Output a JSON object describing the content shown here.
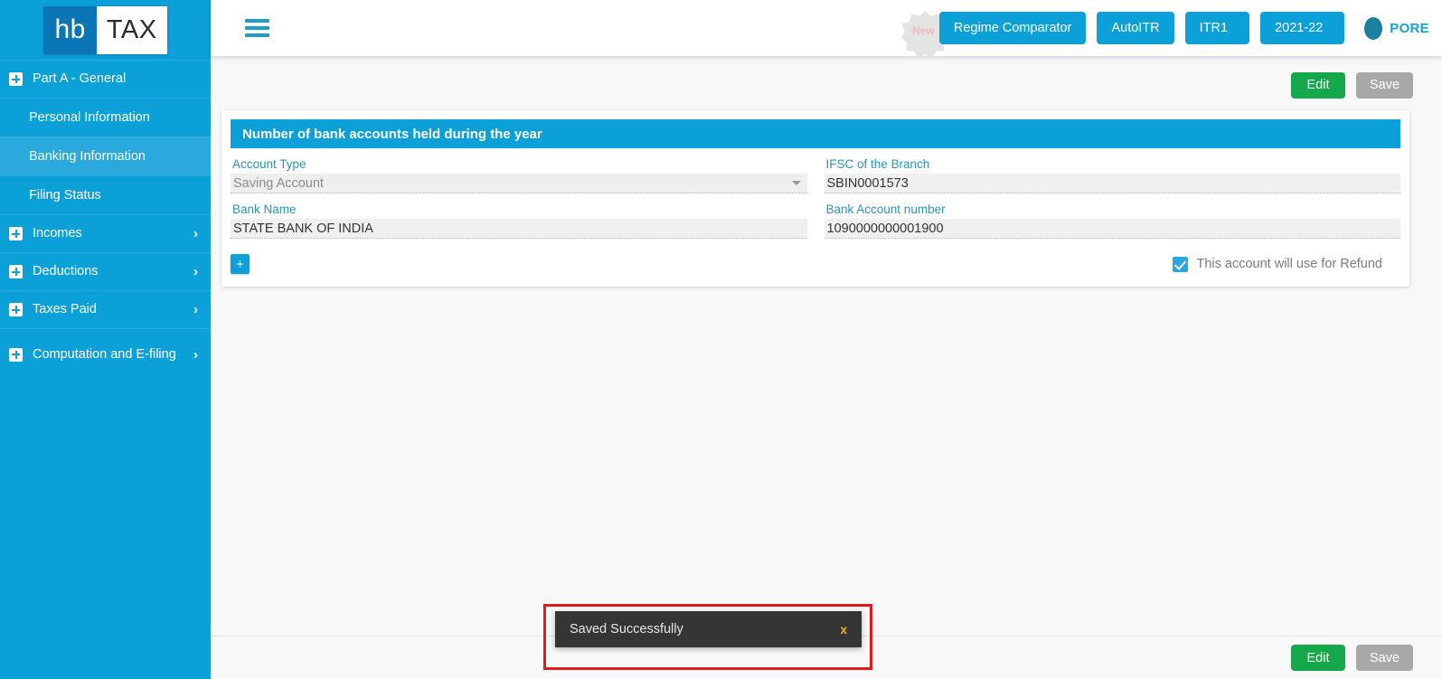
{
  "brand": {
    "logo_primary": "hb",
    "logo_secondary": "TAX",
    "sidebar_color": "#0ca0d8",
    "accent_color": "#0ca0d8",
    "edit_color": "#14a84a",
    "disabled_color": "#a8a8a8"
  },
  "sidebar": {
    "groups": [
      {
        "label": "Part A - General",
        "caret": "ⱟ",
        "children": [
          {
            "label": "Personal Information",
            "active": false
          },
          {
            "label": "Banking Information",
            "active": true
          },
          {
            "label": "Filing Status",
            "active": false
          }
        ]
      },
      {
        "label": "Incomes",
        "caret": "›",
        "children": []
      },
      {
        "label": "Deductions",
        "caret": "›",
        "children": []
      },
      {
        "label": "Taxes Paid",
        "caret": "›",
        "children": []
      },
      {
        "label": "Computation and E-filing",
        "caret": "›",
        "children": []
      }
    ]
  },
  "topbar": {
    "menu_icon": "hamburger-icon",
    "new_badge": "New",
    "regime_comparator": "Regime Comparator",
    "auto_itr": "AutoITR",
    "itr_form": "ITR1",
    "assessment_year": "2021-22",
    "chevron": "ⱟ",
    "user_name": "PORE"
  },
  "actions": {
    "edit_label": "Edit",
    "save_label": "Save"
  },
  "card": {
    "header": "Number of bank accounts held during the year",
    "fields": {
      "account_type": {
        "label": "Account Type",
        "value": "Saving Account"
      },
      "ifsc": {
        "label": "IFSC of the Branch",
        "value": "SBIN0001573"
      },
      "bank_name": {
        "label": "Bank Name",
        "value": "STATE BANK OF INDIA"
      },
      "account_number": {
        "label": "Bank Account number",
        "value": "1090000000001900"
      }
    },
    "add_button": "+",
    "refund_checkbox": {
      "label": "This account will use for Refund",
      "checked": true
    }
  },
  "toast": {
    "message": "Saved Successfully",
    "close_label": "x"
  }
}
